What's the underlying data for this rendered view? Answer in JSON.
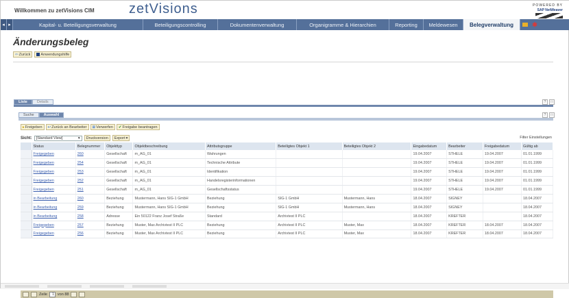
{
  "header": {
    "welcome": "Willkommen zu zetVisions CIM",
    "logo": "zetVisions",
    "sap_line1": "POWERED BY",
    "sap_line2": "SAP NetWeaver"
  },
  "nav": {
    "items": [
      "Kapital- u. Beteiligungsverwaltung",
      "Beteiligungscontrolling",
      "Dokumentenverwaltung",
      "Organigramme & Hierarchien",
      "Reporting",
      "Meldewesen",
      "Belegverwaltung"
    ],
    "active": "Belegverwaltung"
  },
  "page": {
    "title": "Änderungsbeleg",
    "back_label": "Zurück",
    "overview_label": "Anwendungshilfe"
  },
  "tabs": [
    "Liste",
    "Details"
  ],
  "subtabs": [
    "Suche",
    "Auswahl"
  ],
  "toolbar": {
    "release": "Freigeben",
    "return": "Zurück an Bearbeiter",
    "reject": "Verwerfen",
    "request": "Freigabe beantragen"
  },
  "view": {
    "label": "Sicht:",
    "selected": "[Standard View]",
    "print": "Druckversion",
    "export": "Export",
    "filter": "Filter",
    "settings": "Einstellungen"
  },
  "table": {
    "columns": [
      "Status",
      "Belegnummer",
      "Objekttyp",
      "Objektbeschreibung",
      "Attributsgruppe",
      "Beteiligtes Objekt 1",
      "Beteiligtes Objekt 2",
      "Eingabedatum",
      "Bearbeiter",
      "Freigabedatum",
      "Gültig ab"
    ],
    "rows": [
      [
        "Freigegeben",
        "260",
        "Gesellschaft",
        "m_AG_01",
        "Wahrungen",
        "",
        "",
        "19.04.2007",
        "STHELE",
        "19.04.2007",
        "01.01.1999"
      ],
      [
        "Freigegeben",
        "254",
        "Gesellschaft",
        "m_AG_01",
        "Technische Attribute",
        "",
        "",
        "19.04.2007",
        "STHELE",
        "19.04.2007",
        "01.01.1999"
      ],
      [
        "Freigegeben",
        "253",
        "Gesellschaft",
        "m_AG_01",
        "Identifikation",
        "",
        "",
        "19.04.2007",
        "STHELE",
        "19.04.2007",
        "01.01.1999"
      ],
      [
        "Freigegeben",
        "252",
        "Gesellschaft",
        "m_AG_01",
        "Handelsregisterinformationen",
        "",
        "",
        "19.04.2007",
        "STHELE",
        "19.04.2007",
        "01.01.1999"
      ],
      [
        "Freigegeben",
        "251",
        "Gesellschaft",
        "m_AG_01",
        "Gesellschaftsstatus",
        "",
        "",
        "19.04.2007",
        "STHELE",
        "19.04.2007",
        "01.01.1999"
      ],
      [
        "in Bearbeitung",
        "260",
        "Beziehung",
        "Mustermann, Hans SIG-1 GmbH",
        "Beziehung",
        "SIG-1 GmbH",
        "Mustermann, Hans",
        "18.04.2007",
        "SIGNEY",
        "",
        "18.04.2007"
      ],
      [
        "in Bearbeitung",
        "259",
        "Beziehung",
        "Mustermann, Hans SIG-1 GmbH",
        "Beziehung",
        "SIG-1 GmbH",
        "Mustermann, Hans",
        "18.04.2007",
        "SIGNEY",
        "",
        "18.04.2007"
      ],
      [
        "in Bearbeitung",
        "258",
        "Adresse",
        "Ein 50122 Franz Josef Straße",
        "Standard",
        "Archivtest II PLC",
        "",
        "18.04.2007",
        "KREFTER",
        "",
        "18.04.2007"
      ],
      [
        "Freigegeben",
        "257",
        "Beziehung",
        "Muster, Max Archivtest II PLC",
        "Beziehung",
        "Archivtest II PLC",
        "Muster, Max",
        "18.04.2007",
        "KREFTER",
        "18.04.2007",
        "18.04.2007"
      ],
      [
        "Freigegeben",
        "256",
        "Beziehung",
        "Muster, Max Archivtest II PLC",
        "Beziehung",
        "Archivtest II PLC",
        "Muster, Max",
        "18.04.2007",
        "KREFTER",
        "18.04.2007",
        "18.04.2007"
      ]
    ]
  },
  "pager": {
    "label": "Zeile",
    "current": "1",
    "of": "von 88"
  }
}
